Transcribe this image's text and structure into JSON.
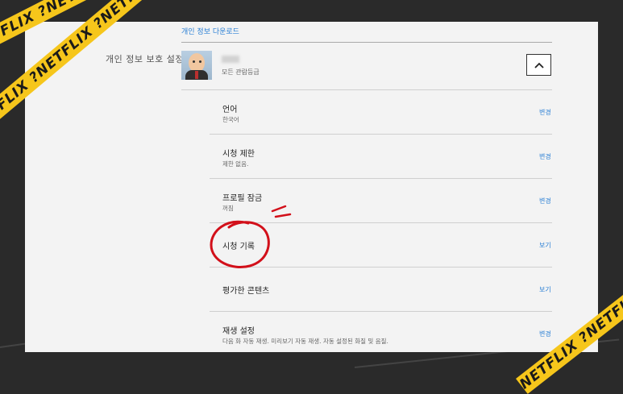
{
  "side_label": "개인 정보 보호 설정",
  "top_link": "개인 정보 다운로드",
  "profile": {
    "subtitle": "모든 관람등급"
  },
  "rows": [
    {
      "title": "언어",
      "sub": "한국어",
      "action": "변경"
    },
    {
      "title": "시청 제한",
      "sub": "제한 없음.",
      "action": "변경"
    },
    {
      "title": "프로필 잠금",
      "sub": "꺼짐",
      "action": "변경"
    },
    {
      "title": "시청 기록",
      "sub": "",
      "action": "보기"
    },
    {
      "title": "평가한 콘텐츠",
      "sub": "",
      "action": "보기"
    },
    {
      "title": "재생 설정",
      "sub": "다음 화 자동 재생. 미리보기 자동 재생. 자동 설정된 화질 및 음질.",
      "action": "변경"
    }
  ],
  "tape_text": "NETFLIX ?NETFLIX ?NETFLIX ?NETFLIX ?NETFLIX ?NETFLIX ?",
  "colors": {
    "accent_link": "#2a7fd4",
    "tape": "#f6c61b",
    "annotation": "#d2101a",
    "background": "#2a2a2a"
  },
  "icons": {
    "collapse": "chevron-up-icon"
  }
}
